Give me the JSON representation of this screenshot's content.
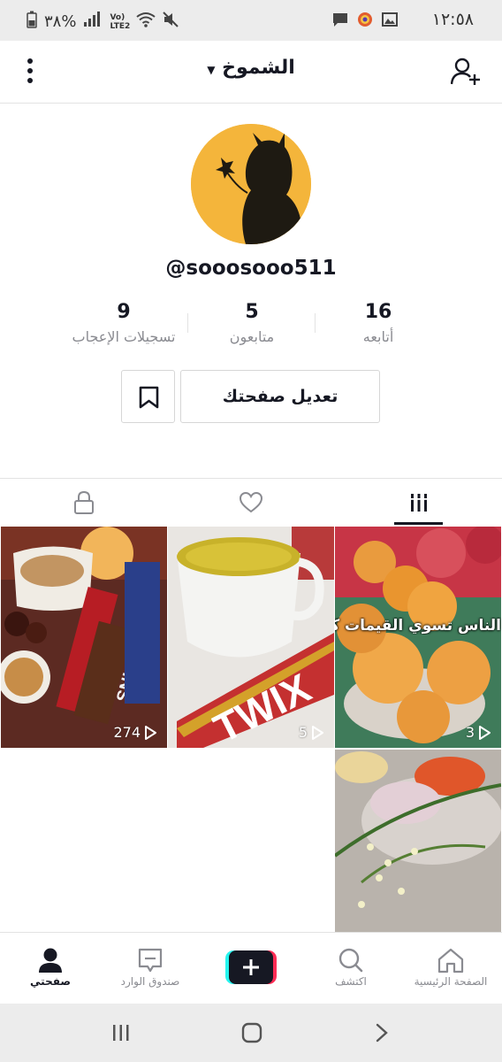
{
  "status_bar": {
    "time": "١٢:٥٨",
    "battery": "%٣٨",
    "network": "Vo) LTE2"
  },
  "header": {
    "title": "الشموخ"
  },
  "profile": {
    "username": "@sooosooo511",
    "stats": [
      {
        "value": "16",
        "label": "أتابعه"
      },
      {
        "value": "5",
        "label": "متابعون"
      },
      {
        "value": "9",
        "label": "تسجيلات الإعجاب"
      }
    ],
    "edit_button": "تعديل صفحتك"
  },
  "videos": [
    {
      "views": "3",
      "caption": "الناس تسوي القيمات كذا"
    },
    {
      "views": "5",
      "caption": ""
    },
    {
      "views": "274",
      "caption": ""
    },
    {
      "views": "",
      "caption": ""
    }
  ],
  "bottom_nav": [
    {
      "label": "الصفحة الرئيسية",
      "icon": "home-icon"
    },
    {
      "label": "اكتشف",
      "icon": "search-icon"
    },
    {
      "label": "",
      "icon": "plus-icon"
    },
    {
      "label": "صندوق الوارد",
      "icon": "inbox-icon"
    },
    {
      "label": "صفحتي",
      "icon": "profile-icon"
    }
  ],
  "colors": {
    "accent_cyan": "#25f4ee",
    "accent_red": "#fe2c55",
    "text": "#161823",
    "muted": "#8a8b91"
  }
}
